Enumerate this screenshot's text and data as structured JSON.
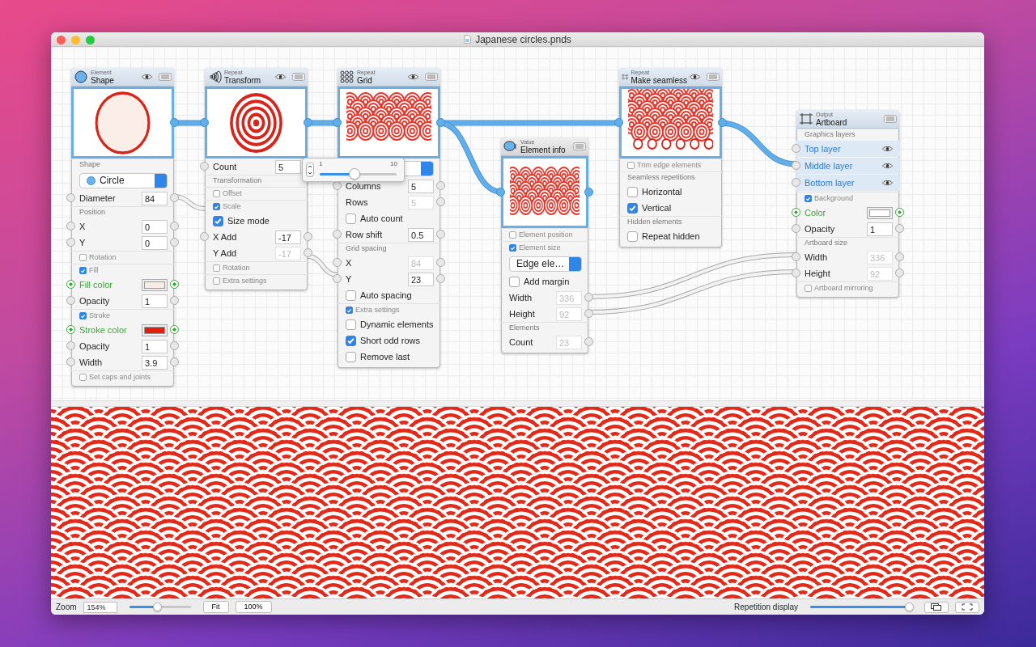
{
  "window": {
    "title": "Japanese circles.pnds"
  },
  "nodes": [
    {
      "kind": "shape",
      "category": "Element",
      "title": "Shape",
      "eye": true,
      "rows": [
        {
          "kind": "section",
          "label": "Shape"
        },
        {
          "kind": "select",
          "label": "Circle",
          "dot": true
        },
        {
          "kind": "field",
          "label": "Diameter",
          "value": "84",
          "in": true,
          "out": true,
          "disabled": false
        },
        {
          "kind": "section",
          "label": "Position"
        },
        {
          "kind": "field",
          "label": "X",
          "value": "0",
          "in": true,
          "out": true,
          "disabled": false
        },
        {
          "kind": "field",
          "label": "Y",
          "value": "0",
          "in": true,
          "out": true,
          "disabled": false
        },
        {
          "kind": "smallcheck",
          "label": "Rotation",
          "checked": false
        },
        {
          "kind": "smallcheck",
          "label": "Fill",
          "checked": true
        },
        {
          "kind": "color",
          "label": "Fill color",
          "color": "#f9ece7",
          "in": true,
          "out": true
        },
        {
          "kind": "field",
          "label": "Opacity",
          "value": "1",
          "in": true,
          "out": true,
          "disabled": false
        },
        {
          "kind": "smallcheck",
          "label": "Stroke",
          "checked": true
        },
        {
          "kind": "color",
          "label": "Stroke color",
          "color": "#e0200f",
          "in": true,
          "out": true
        },
        {
          "kind": "field",
          "label": "Opacity",
          "value": "1",
          "in": true,
          "out": true,
          "disabled": false
        },
        {
          "kind": "field",
          "label": "Width",
          "value": "3.9",
          "in": true,
          "out": true,
          "disabled": false
        },
        {
          "kind": "smallcheck",
          "label": "Set caps and joints",
          "checked": false
        }
      ]
    },
    {
      "kind": "transform",
      "category": "Repeat",
      "title": "Transform",
      "eye": true,
      "rows": [
        {
          "kind": "field",
          "label": "Count",
          "value": "5",
          "in": true,
          "out": false,
          "disabled": false
        },
        {
          "kind": "section",
          "label": "Transformation"
        },
        {
          "kind": "smallcheck",
          "label": "Offset",
          "checked": false
        },
        {
          "kind": "smallcheck",
          "label": "Scale",
          "checked": true
        },
        {
          "kind": "check",
          "label": "Size mode",
          "checked": true
        },
        {
          "kind": "field",
          "label": "X Add",
          "value": "-17",
          "in": true,
          "out": true,
          "disabled": false
        },
        {
          "kind": "field",
          "label": "Y Add",
          "value": "-17",
          "in": false,
          "out": true,
          "disabled": true
        },
        {
          "kind": "smallcheck",
          "label": "Rotation",
          "checked": false
        },
        {
          "kind": "smallcheck",
          "label": "Extra settings",
          "checked": false
        }
      ]
    },
    {
      "kind": "grid",
      "category": "Repeat",
      "title": "Grid",
      "eye": true,
      "rows": [
        {
          "kind": "select",
          "dot": false
        },
        {
          "kind": "field",
          "label": "Columns",
          "value": "5",
          "in": true,
          "out": true,
          "disabled": false
        },
        {
          "kind": "field",
          "label": "Rows",
          "value": "5",
          "in": false,
          "out": true,
          "disabled": true
        },
        {
          "kind": "check",
          "label": "Auto count",
          "checked": false
        },
        {
          "kind": "field",
          "label": "Row shift",
          "value": "0.5",
          "in": true,
          "out": true,
          "disabled": false
        },
        {
          "kind": "section",
          "label": "Grid spacing"
        },
        {
          "kind": "field",
          "label": "X",
          "value": "84",
          "in": true,
          "out": true,
          "disabled": true
        },
        {
          "kind": "field",
          "label": "Y",
          "value": "23",
          "in": true,
          "out": true,
          "disabled": false
        },
        {
          "kind": "check",
          "label": "Auto spacing",
          "checked": false
        },
        {
          "kind": "smallcheck",
          "label": "Extra settings",
          "checked": true
        },
        {
          "kind": "check",
          "label": "Dynamic elements",
          "checked": false
        },
        {
          "kind": "check",
          "label": "Short odd rows",
          "checked": true
        },
        {
          "kind": "check",
          "label": "Remove last",
          "checked": false
        }
      ]
    },
    {
      "kind": "info",
      "category": "Value",
      "title": "Element info",
      "eye": false,
      "rows": [
        {
          "kind": "smallcheck",
          "label": "Element position",
          "checked": false
        },
        {
          "kind": "smallcheck",
          "label": "Element size",
          "checked": true
        },
        {
          "kind": "select",
          "label": "Edge ele…",
          "dot": false
        },
        {
          "kind": "check",
          "label": "Add margin",
          "checked": false
        },
        {
          "kind": "field",
          "label": "Width",
          "value": "336",
          "in": false,
          "out": true,
          "disabled": true
        },
        {
          "kind": "field",
          "label": "Height",
          "value": "92",
          "in": false,
          "out": true,
          "disabled": true
        },
        {
          "kind": "section",
          "label": "Elements"
        },
        {
          "kind": "field",
          "label": "Count",
          "value": "23",
          "in": false,
          "out": true,
          "disabled": true
        }
      ]
    },
    {
      "kind": "seamless",
      "category": "Repeat",
      "title": "Make seamless",
      "eye": true,
      "rows": [
        {
          "kind": "smallcheck",
          "label": "Trim edge elements",
          "checked": false
        },
        {
          "kind": "section",
          "label": "Seamless repetitions"
        },
        {
          "kind": "check",
          "label": "Horizontal",
          "checked": false
        },
        {
          "kind": "check",
          "label": "Vertical",
          "checked": true
        },
        {
          "kind": "section",
          "label": "Hidden elements"
        },
        {
          "kind": "check",
          "label": "Repeat hidden",
          "checked": false
        }
      ]
    },
    {
      "kind": "artboard",
      "category": "Output",
      "title": "Artboard",
      "eye": false,
      "rows": [
        {
          "kind": "section",
          "label": "Graphics layers"
        },
        {
          "kind": "layer",
          "label": "Top layer"
        },
        {
          "kind": "layer",
          "label": "Middle layer"
        },
        {
          "kind": "layer",
          "label": "Bottom layer"
        },
        {
          "kind": "smallcheck",
          "label": "Background",
          "checked": true
        },
        {
          "kind": "color",
          "label": "Color",
          "color": "#ffffff",
          "in": true,
          "out": true
        },
        {
          "kind": "field",
          "label": "Opacity",
          "value": "1",
          "in": true,
          "out": true,
          "disabled": false
        },
        {
          "kind": "section",
          "label": "Artboard size"
        },
        {
          "kind": "field",
          "label": "Width",
          "value": "336",
          "in": true,
          "out": true,
          "disabled": true
        },
        {
          "kind": "field",
          "label": "Height",
          "value": "92",
          "in": true,
          "out": true,
          "disabled": true
        },
        {
          "kind": "smallcheck",
          "label": "Artboard mirroring",
          "checked": false
        }
      ]
    }
  ],
  "count_popup": {
    "min": "1",
    "max": "10",
    "level": 0.45
  },
  "status_bar": {
    "zoom_label": "Zoom",
    "zoom_value": "154%",
    "zoom_slider": {
      "level": 0.45
    },
    "buttons": [
      "Fit",
      "100%"
    ],
    "repetition_label": "Repetition display",
    "repetition_slider": {
      "level": 0.97
    }
  }
}
